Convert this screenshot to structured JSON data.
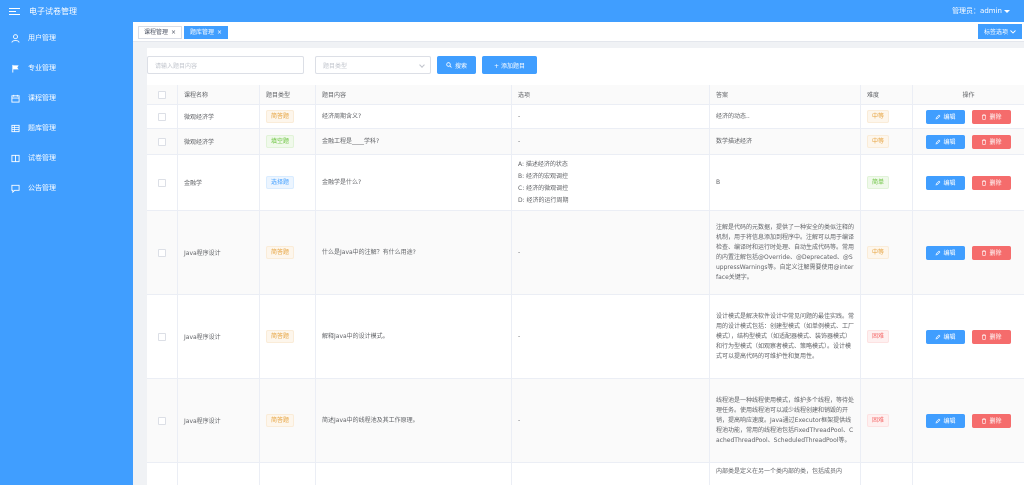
{
  "brand": {
    "title": "电子试卷管理"
  },
  "sidebar": {
    "items": [
      {
        "label": "用户管理",
        "icon": "user-icon"
      },
      {
        "label": "专业管理",
        "icon": "flag-icon"
      },
      {
        "label": "课程管理",
        "icon": "calendar-icon"
      },
      {
        "label": "题库管理",
        "icon": "grid-icon"
      },
      {
        "label": "试卷管理",
        "icon": "columns-icon"
      },
      {
        "label": "公告管理",
        "icon": "chat-icon"
      }
    ]
  },
  "header": {
    "admin_label": "管理员：admin"
  },
  "tabs": [
    {
      "label": "课程管理",
      "close": "×"
    },
    {
      "label": "题库管理",
      "close": "×"
    }
  ],
  "tab_options_label": "标签选项",
  "search": {
    "placeholder": "请输入题目内容",
    "type_placeholder": "题目类型",
    "search_label": "搜索",
    "add_label": "+ 添加题目"
  },
  "table": {
    "columns": [
      "课程名称",
      "题目类型",
      "题目内容",
      "选项",
      "答案",
      "难度",
      "操作"
    ],
    "edit_label": "编辑",
    "delete_label": "删除",
    "rows": [
      {
        "course": "微观经济学",
        "type": "简答题",
        "content": "经济周期含义?",
        "options": [
          "-"
        ],
        "answer": "经济的动态..",
        "difficulty": "中等"
      },
      {
        "course": "微观经济学",
        "type": "填空题",
        "content": "金融工程是____学科?",
        "options": [
          "-"
        ],
        "answer": "数学描述经济",
        "difficulty": "中等"
      },
      {
        "course": "金融学",
        "type": "选择题",
        "content": "金融学是什么?",
        "options": [
          "A: 描述经济的状态",
          "B: 经济的宏观调控",
          "C: 经济的微观调控",
          "D: 经济的运行周期"
        ],
        "answer": "B",
        "difficulty": "简单"
      },
      {
        "course": "Java程序设计",
        "type": "简答题",
        "content": "什么是Java中的注解？有什么用途?",
        "options": [
          "-"
        ],
        "answer": "注解是代码的元数据，提供了一种安全的类似注释的机制，用于将信息添加到程序中。注解可以用于编译检查、编译时和运行时处理、自动生成代码等。常用的内置注解包括@Override、@Deprecated、@SuppressWarnings等。自定义注解需要使用@interface关键字。",
        "difficulty": "中等"
      },
      {
        "course": "Java程序设计",
        "type": "简答题",
        "content": "解释Java中的设计模式。",
        "options": [
          "-"
        ],
        "answer": "设计模式是解决软件设计中常见问题的最佳实践。常用的设计模式包括：创建型模式（如单例模式、工厂模式），结构型模式（如适配器模式、装饰器模式）和行为型模式（如观察者模式、策略模式）。设计模式可以提高代码的可维护性和复用性。",
        "difficulty": "困难"
      },
      {
        "course": "Java程序设计",
        "type": "简答题",
        "content": "简述Java中的线程池及其工作原理。",
        "options": [
          "-"
        ],
        "answer": "线程池是一种线程使用模式，维护多个线程，等待处理任务。使用线程池可以减少线程创建和销毁的开销，提高响应速度。Java通过Executor框架提供线程池功能，常用的线程池包括FixedThreadPool、CachedThreadPool、ScheduledThreadPool等。",
        "difficulty": "困难"
      },
      {
        "course": "",
        "type": "",
        "content": "",
        "options": [
          ""
        ],
        "answer": "内部类是定义在另一个类内部的类，包括成员内",
        "difficulty": ""
      }
    ]
  },
  "colors": {
    "primary": "#409eff",
    "danger": "#f56c6c",
    "warning": "#e6a23c",
    "success": "#67c23a"
  }
}
